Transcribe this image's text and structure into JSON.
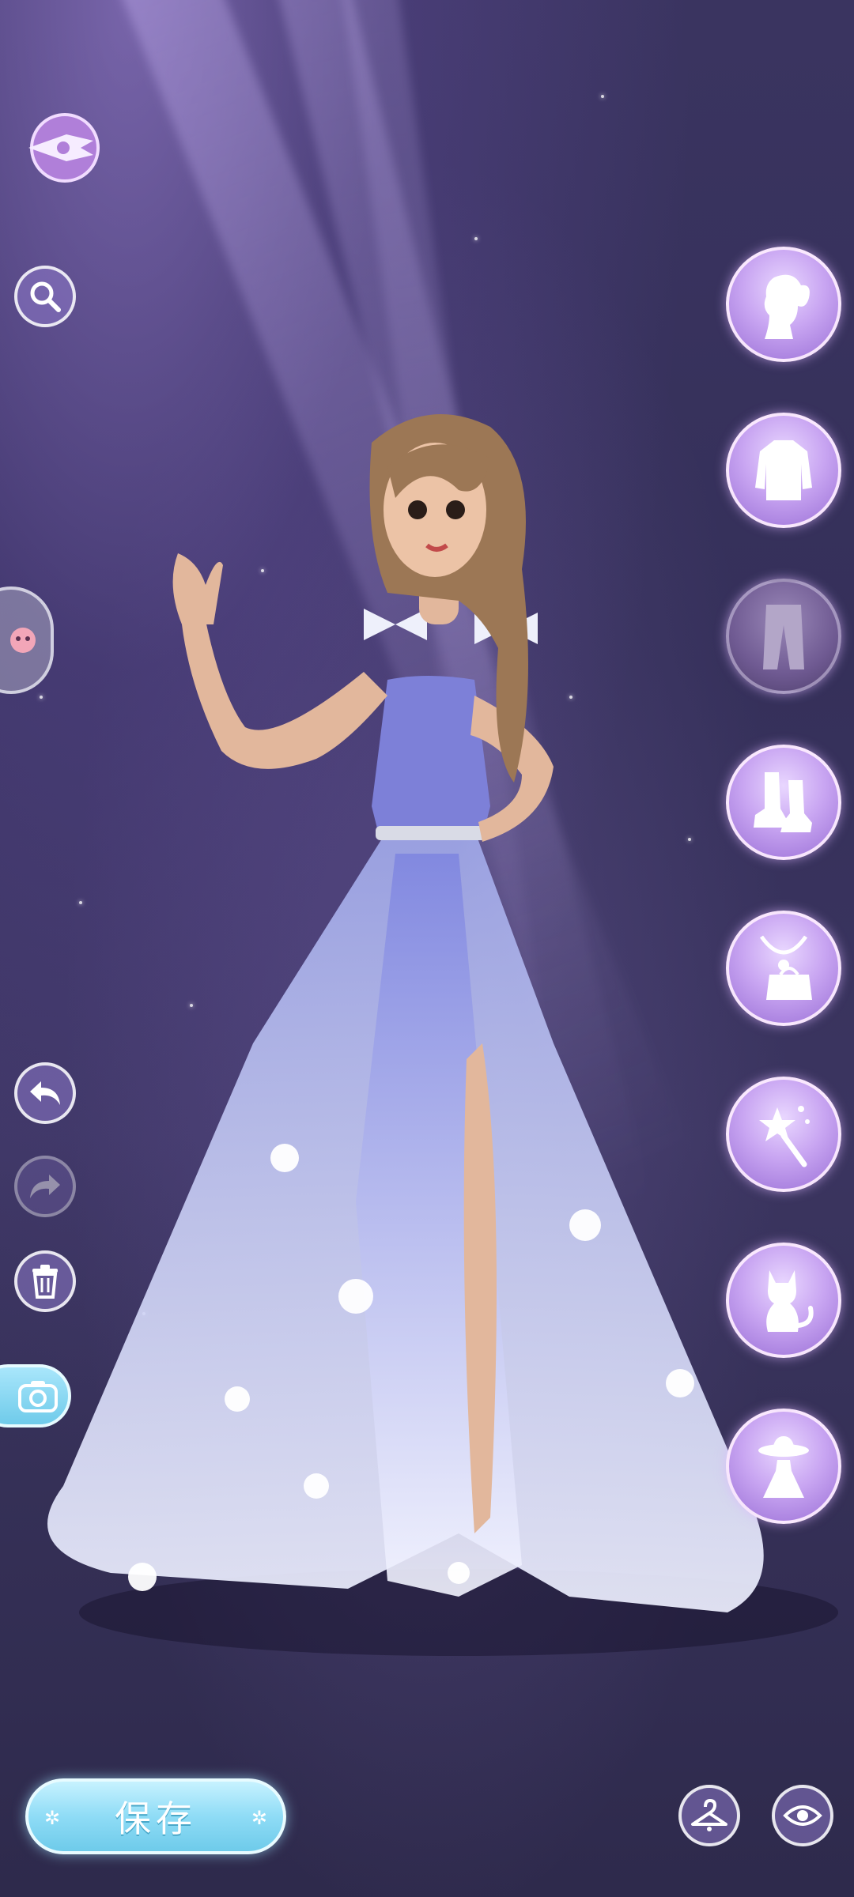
{
  "save_button": {
    "label": "保存"
  },
  "icons": {
    "back": "back-arrow-wing-icon",
    "search": "search-icon",
    "pet": "pet-companion-icon",
    "undo": "undo-icon",
    "redo": "redo-icon",
    "delete": "trash-icon",
    "camera": "camera-icon",
    "hanger": "hanger-icon",
    "eye": "eye-icon"
  },
  "categories": [
    {
      "id": "hair",
      "icon": "hair-silhouette-icon",
      "state": "normal"
    },
    {
      "id": "top",
      "icon": "top-clothing-icon",
      "state": "normal"
    },
    {
      "id": "bottom",
      "icon": "pants-icon",
      "state": "dimmed"
    },
    {
      "id": "shoes",
      "icon": "boots-icon",
      "state": "normal"
    },
    {
      "id": "accessories",
      "icon": "necklace-bag-icon",
      "state": "normal"
    },
    {
      "id": "handheld",
      "icon": "magic-wand-icon",
      "state": "normal"
    },
    {
      "id": "pet",
      "icon": "cat-icon",
      "state": "normal"
    },
    {
      "id": "outfit",
      "icon": "hat-dress-icon",
      "state": "normal"
    }
  ],
  "colors": {
    "accent": "#c9a6f2",
    "save_button": "#8fdcf6",
    "background": "#35305a"
  }
}
